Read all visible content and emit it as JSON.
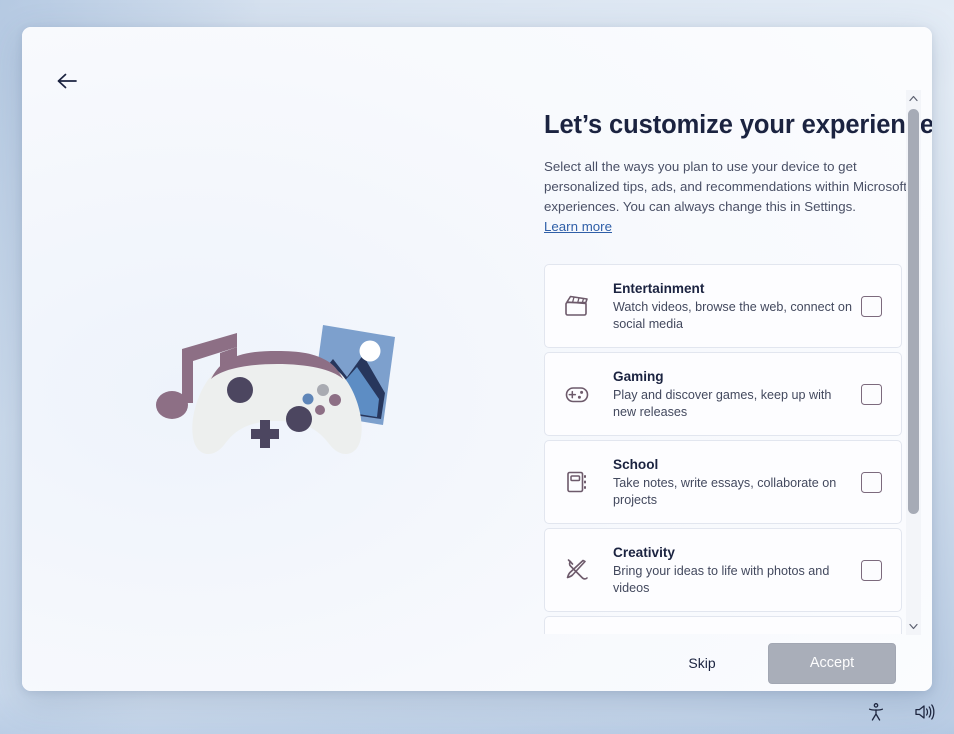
{
  "desktop": {
    "tray": [
      {
        "name": "accessibility-icon",
        "label": "Accessibility"
      },
      {
        "name": "volume-icon",
        "label": "Volume"
      }
    ]
  },
  "window": {
    "back_button": {
      "icon": "arrow-left-icon",
      "label": "Back"
    }
  },
  "illustration": {
    "name": "gaming-entertainment-illustration",
    "elements": [
      "music-note",
      "game-controller",
      "photo-card"
    ]
  },
  "main": {
    "title": "Let’s customize your experience",
    "description": "Select all the ways you plan to use your device to get personalized tips, ads, and recommendations within Microsoft experiences. You can always change this in Settings.",
    "learn_more": "Learn more",
    "options": [
      {
        "icon": "clapperboard-icon",
        "title": "Entertainment",
        "description": "Watch videos, browse the web, connect on social media",
        "checked": false
      },
      {
        "icon": "game-controller-icon",
        "title": "Gaming",
        "description": "Play and discover games, keep up with new releases",
        "checked": false
      },
      {
        "icon": "notebook-icon",
        "title": "School",
        "description": "Take notes, write essays, collaborate on projects",
        "checked": false
      },
      {
        "icon": "paintbrush-pencil-icon",
        "title": "Creativity",
        "description": "Bring your ideas to life with photos and videos",
        "checked": false
      },
      {
        "icon": "briefcase-icon",
        "title": "",
        "description": "",
        "checked": false
      }
    ]
  },
  "scrollbar": {
    "up_arrow": "chevron-up-icon",
    "down_arrow": "chevron-down-icon"
  },
  "footer": {
    "skip_label": "Skip",
    "accept_label": "Accept",
    "accept_disabled": true
  },
  "colors": {
    "accent_link": "#2f5fa8",
    "icon_mauve": "#6d5a6b",
    "title_text": "#1b2340",
    "body_text": "#4a5066",
    "accept_disabled_bg": "#a9aeb9",
    "card_border": "#e2e6ef",
    "scrollbar_thumb": "#a6abb6"
  }
}
